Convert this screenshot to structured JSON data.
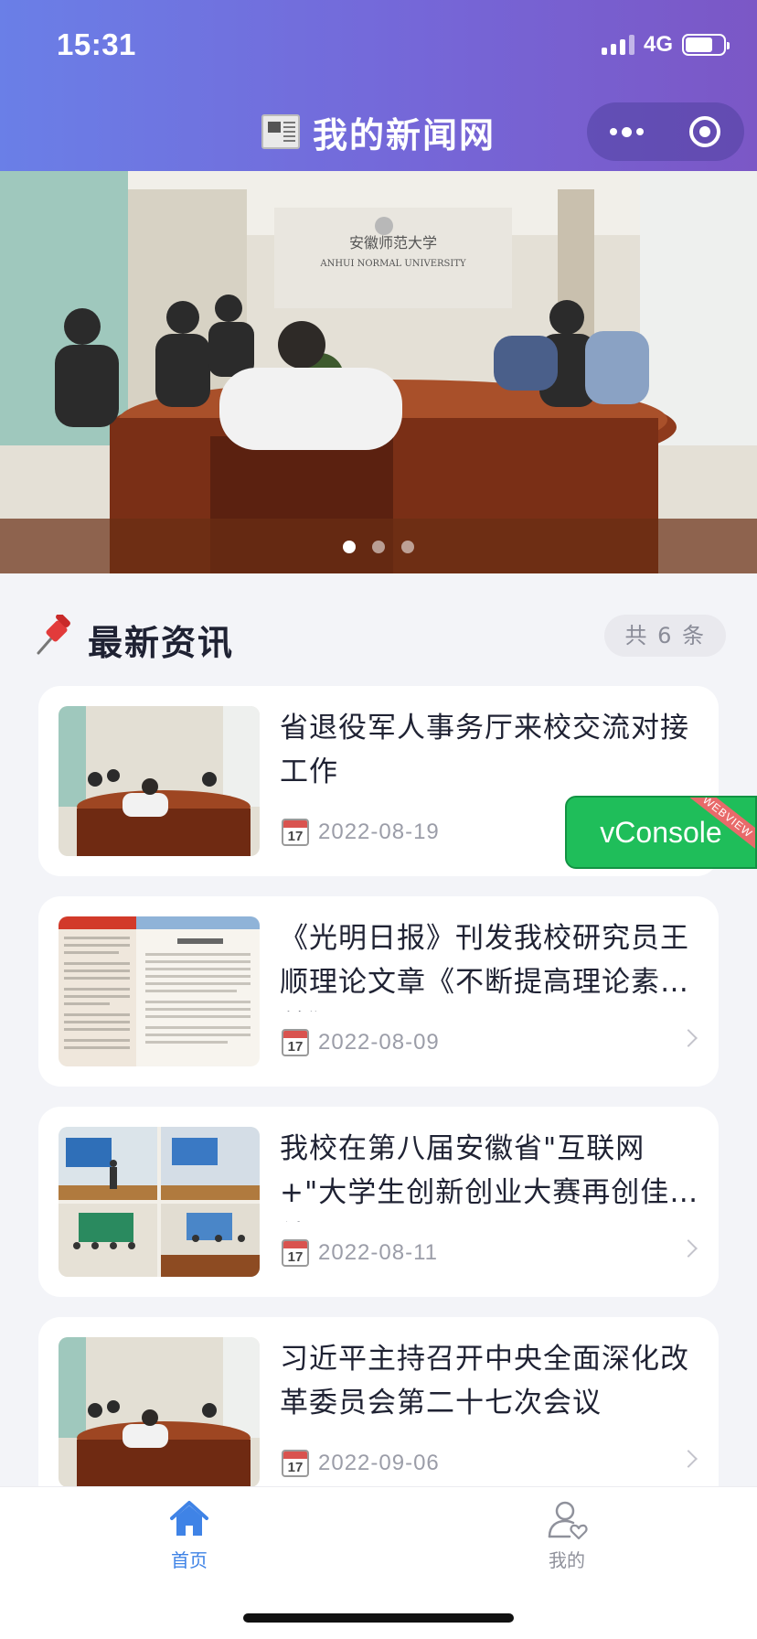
{
  "status_bar": {
    "time": "15:31",
    "network": "4G"
  },
  "nav": {
    "title": "我的新闻网",
    "icon": "newspaper-icon",
    "more_icon": "more-dots-icon",
    "close_icon": "capsule-close-icon"
  },
  "banner": {
    "photo_sign": "安徽师范大学",
    "photo_sign_en": "ANHUI NORMAL UNIVERSITY",
    "slides": 3,
    "active_slide": 1
  },
  "section": {
    "icon": "pushpin-icon",
    "title": "最新资讯",
    "count": "共 6 条"
  },
  "news": [
    {
      "title": "省退役军人事务厅来校交流对接工作",
      "date": "2022-08-19",
      "calendar_day": "17",
      "thumb": "meeting-photo"
    },
    {
      "title": "《光明日报》刊发我校研究员王顺理论文章《不断提高理论素养》",
      "date": "2022-08-09",
      "calendar_day": "17",
      "thumb": "newspaper-page"
    },
    {
      "title": "我校在第八届安徽省\"互联网+\"大学生创新创业大赛再创佳绩",
      "date": "2022-08-11",
      "calendar_day": "17",
      "thumb": "competition-collage"
    },
    {
      "title": "习近平主持召开中央全面深化改革委员会第二十七次会议",
      "date": "2022-09-06",
      "calendar_day": "17",
      "thumb": "meeting-photo"
    }
  ],
  "vconsole": {
    "label": "vConsole",
    "ribbon": "WEBVIEW"
  },
  "tabbar": {
    "items": [
      {
        "label": "首页",
        "icon": "home-icon",
        "active": true
      },
      {
        "label": "我的",
        "icon": "user-heart-icon",
        "active": false
      }
    ]
  },
  "colors": {
    "header_start": "#6a7fe7",
    "header_end": "#7b57c6",
    "active_tab": "#3f83e6",
    "vconsole": "#1fbe5a"
  }
}
